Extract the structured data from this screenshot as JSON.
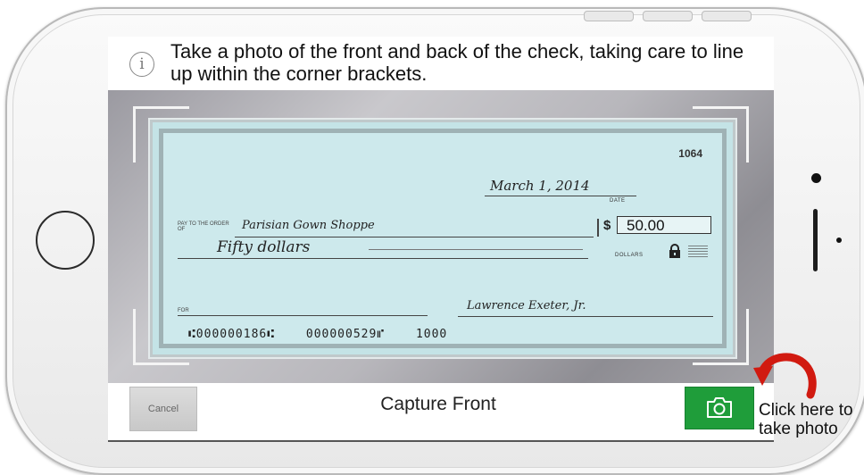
{
  "instruction": {
    "icon": "info-icon",
    "text": "Take a photo of the front and back of the check, taking care to line up within the corner brackets."
  },
  "check": {
    "number": "1064",
    "date": "March 1, 2014",
    "date_label": "DATE",
    "pay_to_label": "PAY TO THE ORDER OF",
    "payee": "Parisian Gown Shoppe",
    "currency_symbol": "$",
    "amount": "50.00",
    "amount_words": "Fifty dollars",
    "dollars_label": "DOLLARS",
    "memo_label": "FOR",
    "signature": "Lawrence Exeter, Jr.",
    "micr": {
      "routing": "⑆000000186⑆",
      "account": "000000529⑈",
      "check_number": "1000"
    }
  },
  "bottom_bar": {
    "cancel_label": "Cancel",
    "title": "Capture Front",
    "camera_icon": "camera-icon",
    "camera_color": "#1f9d3a"
  },
  "callout": {
    "text": "Click here to take photo",
    "arrow_color": "#d11a10"
  }
}
